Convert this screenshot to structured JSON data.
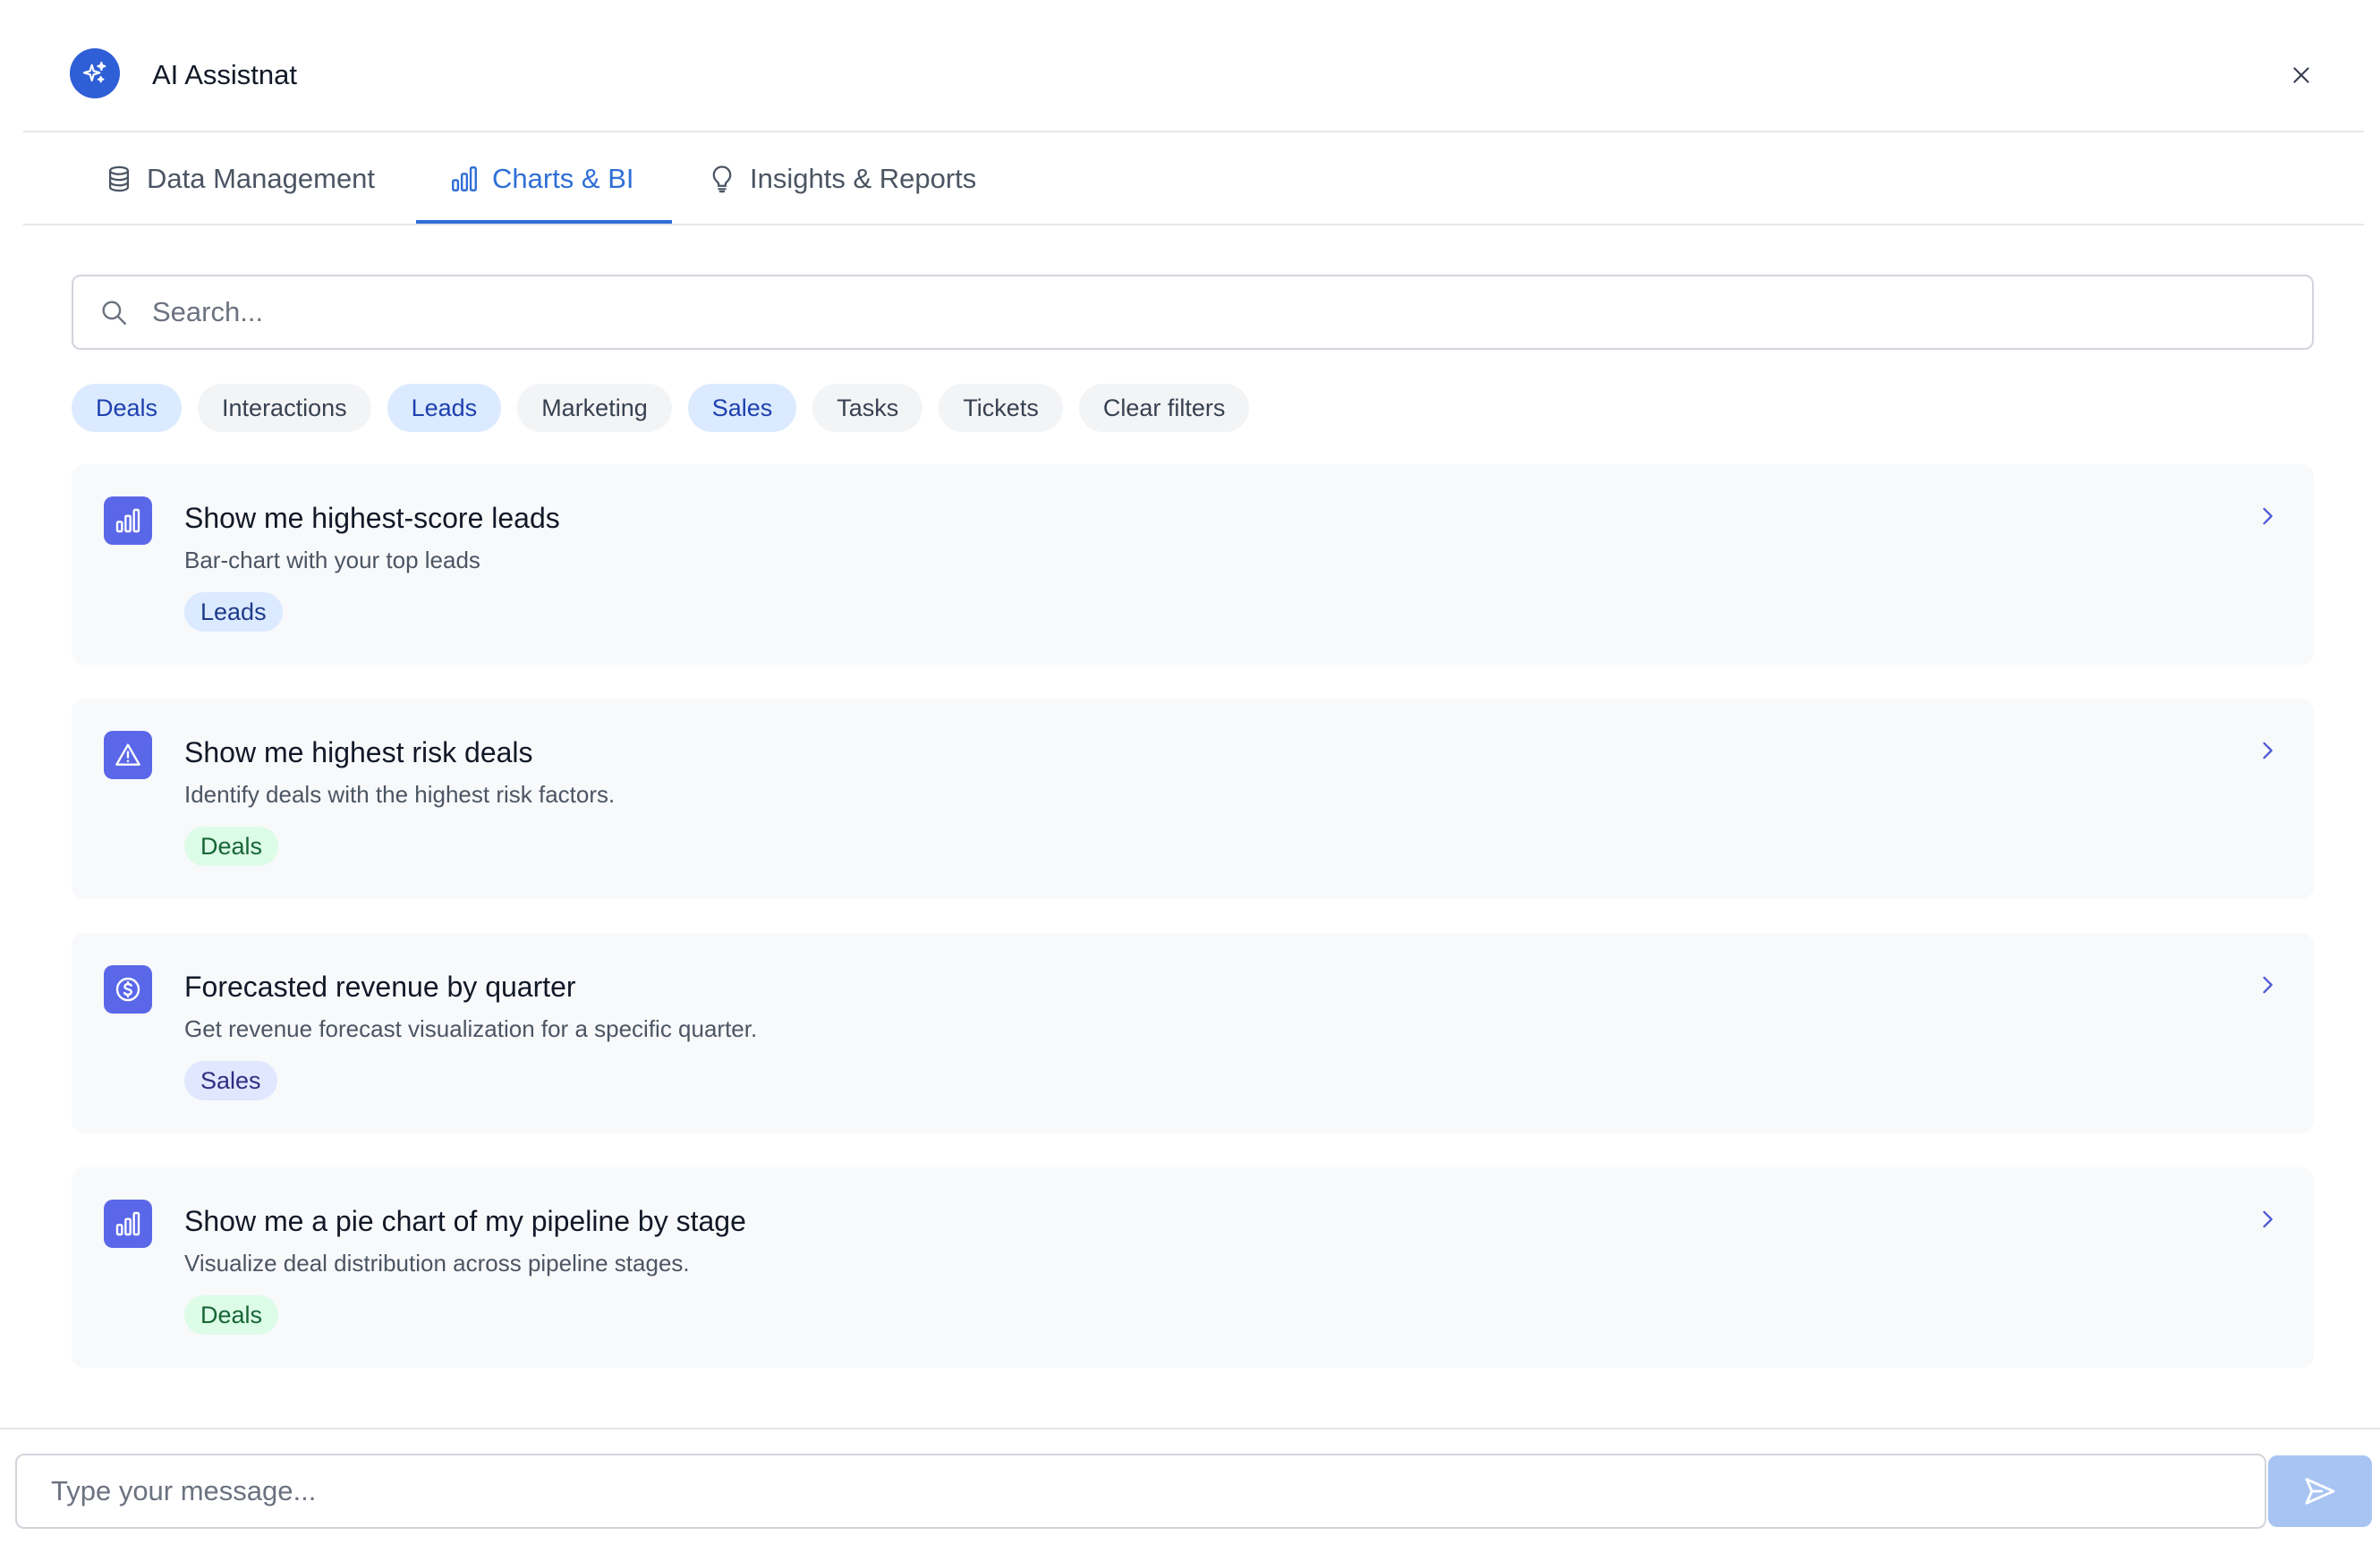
{
  "header": {
    "title": "AI Assistnat",
    "logo_icon": "sparkles-icon",
    "close_icon": "close-icon"
  },
  "tabs": [
    {
      "label": "Data Management",
      "icon": "database-icon",
      "active": false
    },
    {
      "label": "Charts & BI",
      "icon": "bar-chart-icon",
      "active": true
    },
    {
      "label": "Insights & Reports",
      "icon": "lightbulb-icon",
      "active": false
    }
  ],
  "search": {
    "placeholder": "Search...",
    "value": ""
  },
  "filters": [
    {
      "label": "Deals",
      "selected": true
    },
    {
      "label": "Interactions",
      "selected": false
    },
    {
      "label": "Leads",
      "selected": true
    },
    {
      "label": "Marketing",
      "selected": false
    },
    {
      "label": "Sales",
      "selected": true
    },
    {
      "label": "Tasks",
      "selected": false
    },
    {
      "label": "Tickets",
      "selected": false
    },
    {
      "label": "Clear filters",
      "selected": false
    }
  ],
  "cards": [
    {
      "title": "Show me highest-score leads",
      "description": "Bar-chart with your top leads",
      "tag": "Leads",
      "icon": "bar-chart-icon"
    },
    {
      "title": "Show me highest risk deals",
      "description": "Identify deals with the highest risk factors.",
      "tag": "Deals",
      "icon": "warning-triangle-icon"
    },
    {
      "title": "Forecasted revenue by quarter",
      "description": "Get revenue forecast visualization for a specific quarter.",
      "tag": "Sales",
      "icon": "dollar-circle-icon"
    },
    {
      "title": "Show me a pie chart of my pipeline by stage",
      "description": "Visualize deal distribution across pipeline stages.",
      "tag": "Deals",
      "icon": "bar-chart-icon"
    }
  ],
  "composer": {
    "placeholder": "Type your message...",
    "value": "",
    "send_icon": "send-icon"
  },
  "colors": {
    "accent": "#2f6fd6",
    "card_icon_bg": "#5a67e8",
    "send_button_bg": "#a8c4f2"
  }
}
